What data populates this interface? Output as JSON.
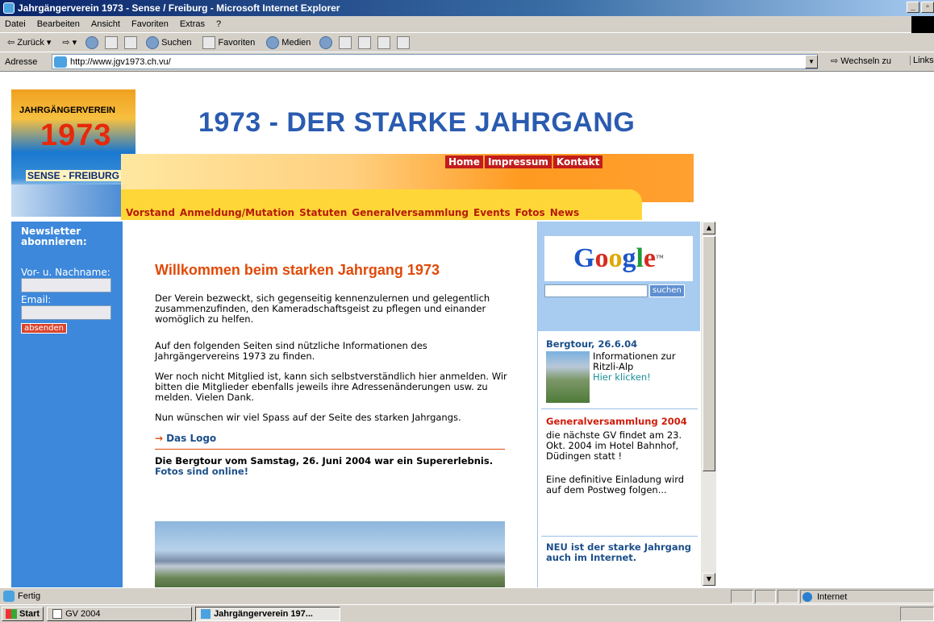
{
  "window": {
    "title": "Jahrgängerverein 1973 - Sense / Freiburg - Microsoft Internet Explorer"
  },
  "menu": [
    "Datei",
    "Bearbeiten",
    "Ansicht",
    "Favoriten",
    "Extras",
    "?"
  ],
  "toolbar": {
    "back": "Zurück",
    "search": "Suchen",
    "favorites": "Favoriten",
    "media": "Medien"
  },
  "address": {
    "label": "Adresse",
    "url": "http://www.jgv1973.ch.vu/",
    "go": "Wechseln zu",
    "links": "Links"
  },
  "site": {
    "logo": {
      "top": "JAHRGÄNGERVEREIN",
      "year": "1973",
      "bottom": "SENSE - FREIBURG"
    },
    "headline": "1973 - DER STARKE JAHRGANG",
    "topnav": [
      "Home",
      "Impressum",
      "Kontakt"
    ],
    "mainnav": [
      "Vorstand",
      "Anmeldung/Mutation",
      "Statuten",
      "Generalversammlung",
      "Events",
      "Fotos",
      "News"
    ],
    "newsletter": {
      "heading": "Newsletter abonnieren:",
      "name_label": "Vor- u. Nachname:",
      "email_label": "Email:",
      "submit": "absenden"
    },
    "welcome": {
      "title": "Willkommen beim starken Jahrgang 1973",
      "p1": "Der Verein bezweckt, sich gegenseitig kennenzulernen und gelegentlich zusammenzufinden, den Kameradschaftsgeist zu pflegen und einander womöglich zu helfen.",
      "p2": "Auf den folgenden Seiten sind nützliche Informationen des Jahrgängervereins 1973 zu finden.",
      "p3": "Wer noch nicht Mitglied ist, kann sich selbstverständlich hier anmelden. Wir bitten die Mitglieder ebenfalls jeweils ihre Adressenänderungen usw. zu melden. Vielen Dank.",
      "p4": "Nun wünschen wir viel Spass auf der Seite des starken Jahrgangs.",
      "logo_link": "Das Logo",
      "bergtour_text": "Die Bergtour vom Samstag, 26. Juni 2004 war ein Supererlebnis.",
      "bergtour_link": "Fotos sind online!"
    },
    "google": {
      "logo": "Google",
      "tm": "™",
      "button": "suchen"
    },
    "news": [
      {
        "title": "Bergtour, 26.6.04",
        "text": "Informationen zur Ritzli-Alp",
        "link": "Hier klicken!"
      },
      {
        "title": "Generalversammlung 2004",
        "text": "die nächste GV findet am 23. Okt. 2004 im Hotel Bahnhof, Düdingen statt !",
        "text2": "Eine definitive Einladung wird auf dem Postweg folgen..."
      },
      {
        "title": "NEU ist der starke Jahrgang auch im Internet."
      }
    ]
  },
  "status": {
    "text": "Fertig",
    "zone": "Internet"
  },
  "taskbar": {
    "start": "Start",
    "tasks": [
      "GV 2004",
      "Jahrgängerverein 197..."
    ]
  },
  "colors": {
    "title_blue": "#0a246a",
    "headline": "#2a5bb0",
    "nav_red": "#c21c1c",
    "nav_yellow": "#ffd638",
    "side_blue": "#3d88db",
    "accent_orange": "#e04a08"
  }
}
